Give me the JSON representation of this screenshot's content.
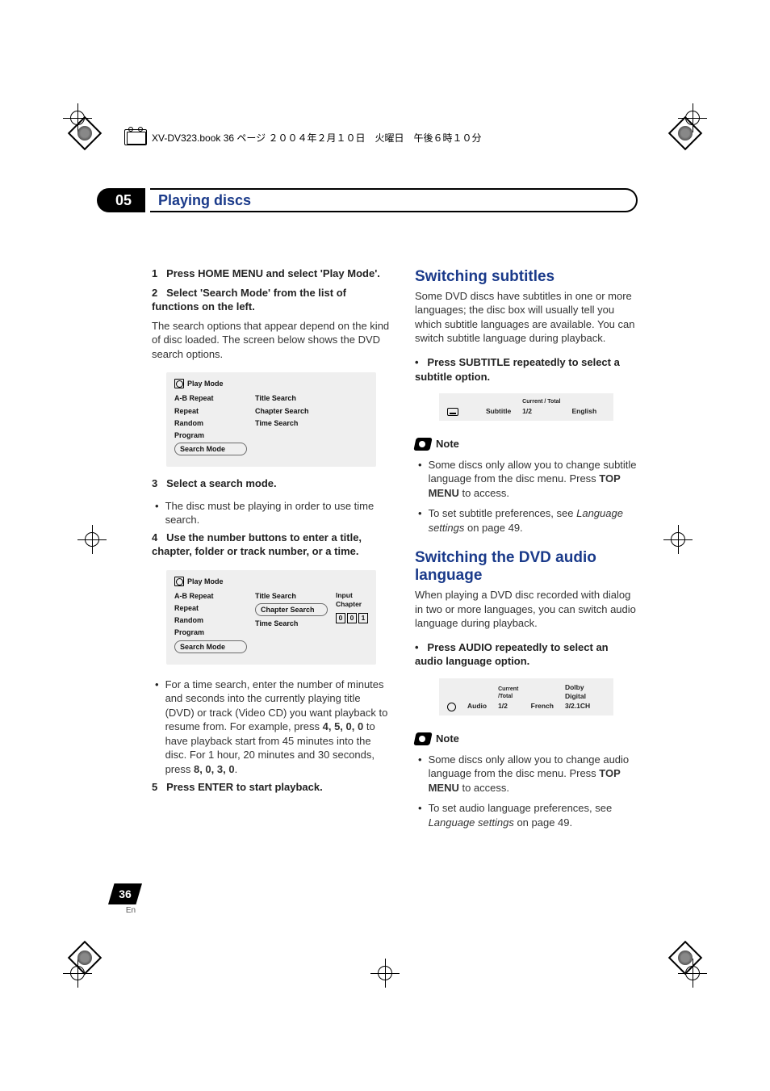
{
  "bookline": "XV-DV323.book 36 ページ ２００４年２月１０日　火曜日　午後６時１０分",
  "chapter": {
    "num": "05",
    "title": "Playing discs"
  },
  "left": {
    "s1": {
      "n": "1",
      "t": "Press HOME MENU and select 'Play Mode'."
    },
    "s2": {
      "n": "2",
      "t": "Select 'Search Mode' from the list of functions on the left."
    },
    "s2_body": "The search options that appear depend on the kind of disc loaded. The screen below shows the DVD search options.",
    "osd1": {
      "title": "Play Mode",
      "left": [
        "A-B Repeat",
        "Repeat",
        "Random",
        "Program",
        "Search Mode"
      ],
      "mid": [
        "Title Search",
        "Chapter Search",
        "Time Search"
      ]
    },
    "s3": {
      "n": "3",
      "t": "Select a search mode."
    },
    "s3_b1": "The disc must be playing in order to use time search.",
    "s4": {
      "n": "4",
      "t": "Use the number buttons to enter a title, chapter, folder or track number, or a time."
    },
    "osd2": {
      "title": "Play Mode",
      "left": [
        "A-B Repeat",
        "Repeat",
        "Random",
        "Program",
        "Search Mode"
      ],
      "mid": [
        "Title Search",
        "Chapter Search",
        "Time Search"
      ],
      "right_label": "Input Chapter",
      "digits": [
        "0",
        "0",
        "1"
      ]
    },
    "s4_b1_a": "For a time search, enter the number of minutes and seconds into the currently playing title (DVD) or track (Video CD) you want playback to resume from. For example, press ",
    "s4_b1_keys1": "4, 5, 0, 0",
    "s4_b1_b": " to have playback start from 45 minutes into the disc. For 1 hour, 20 minutes and 30 seconds, press ",
    "s4_b1_keys2": "8, 0, 3, 0",
    "s4_b1_c": ".",
    "s5": {
      "n": "5",
      "t": "Press ENTER to start playback."
    }
  },
  "right": {
    "h1": "Switching subtitles",
    "h1_body": "Some DVD discs have subtitles in one or more languages; the disc box will usually tell you which subtitle languages are available. You can switch subtitle language during playback.",
    "h1_step": "Press SUBTITLE repeatedly to select a subtitle option.",
    "sub_status": {
      "label": "Subtitle",
      "ct_label": "Current / Total",
      "ct": "1/2",
      "lang": "English"
    },
    "note": "Note",
    "h1_n1_a": "Some discs only allow you to change subtitle language from the disc menu. Press ",
    "h1_n1_b": "TOP MENU",
    "h1_n1_c": " to access.",
    "h1_n2_a": "To set subtitle preferences, see ",
    "h1_n2_b": "Language settings",
    "h1_n2_c": " on page 49.",
    "h2": "Switching the DVD audio language",
    "h2_body": "When playing a DVD disc recorded with dialog in two or more languages, you can switch audio language during playback.",
    "h2_step": "Press AUDIO repeatedly to select an audio language option.",
    "aud_status": {
      "label": "Audio",
      "ct_label": "Current /Total",
      "ct": "1/2",
      "lang": "French",
      "codec": "Dolby Digital 3/2.1CH"
    },
    "h2_n1_a": "Some discs only allow you to change audio language from the disc menu. Press ",
    "h2_n1_b": "TOP MENU",
    "h2_n1_c": " to access.",
    "h2_n2_a": "To set audio language preferences, see ",
    "h2_n2_b": "Language settings",
    "h2_n2_c": " on page 49."
  },
  "page": {
    "num": "36",
    "lang": "En"
  }
}
